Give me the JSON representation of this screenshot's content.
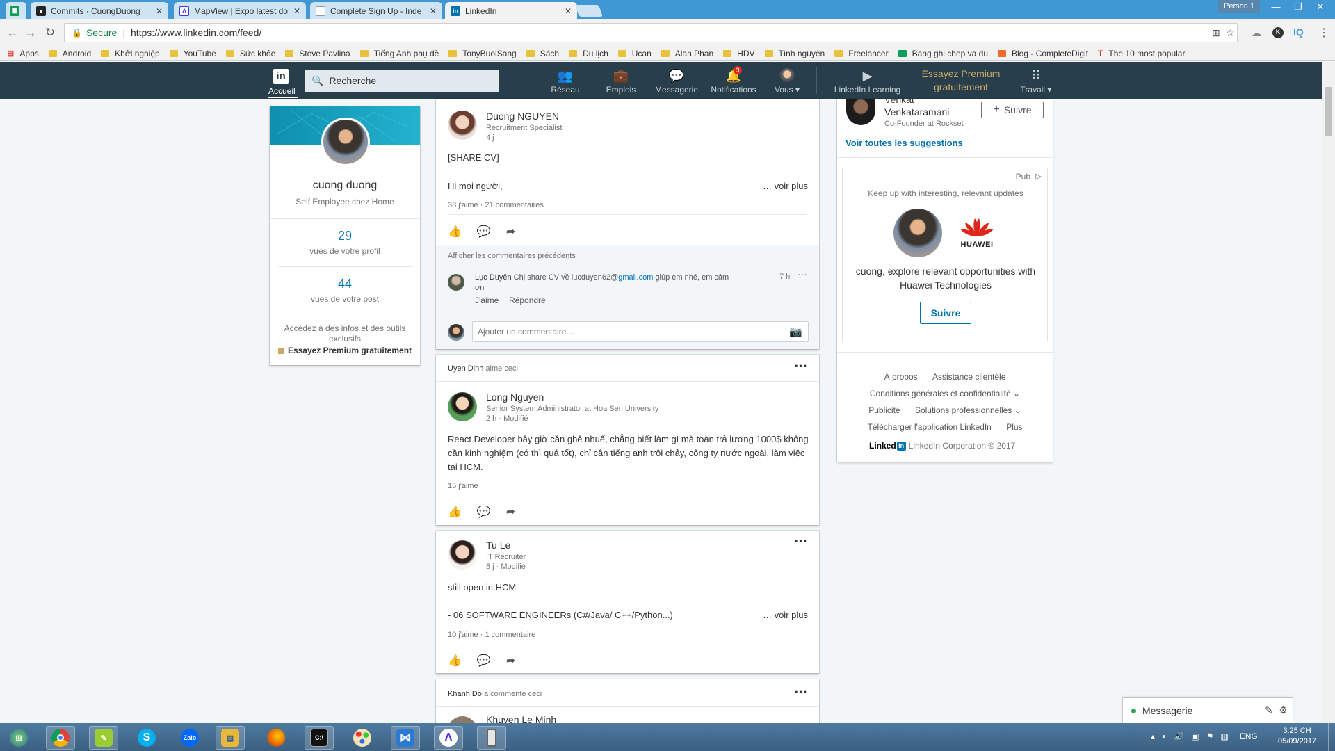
{
  "browser": {
    "tabs": [
      {
        "title": "Commits · CuongDuong",
        "icon": "github-icon"
      },
      {
        "title": "MapView | Expo latest do",
        "icon": "expo-icon"
      },
      {
        "title": "Complete Sign Up - Inde",
        "icon": "page-icon"
      },
      {
        "title": "LinkedIn",
        "icon": "linkedin-icon",
        "active": true
      }
    ],
    "profile_button": "Person 1",
    "secure_label": "Secure",
    "url": "https://www.linkedin.com/feed/",
    "bookmarks": [
      "Apps",
      "Android",
      "Khởi nghiệp",
      "YouTube",
      "Sức khỏe",
      "Steve Pavlina",
      "Tiếng Anh phụ đề",
      "TonyBuoiSang",
      "Sách",
      "Du lịch",
      "Ucan",
      "Alan Phan",
      "HDV",
      "Tình nguyện",
      "Freelancer",
      "Bang ghi chep va du",
      "Blog - CompleteDigit",
      "The 10 most popular"
    ],
    "extension_label": "IQ"
  },
  "linkedin_header": {
    "home": "Accueil",
    "search_placeholder": "Recherche",
    "nav": [
      "Réseau",
      "Emplois",
      "Messagerie",
      "Notifications",
      "Vous",
      "LinkedIn Learning",
      "Travail"
    ],
    "notifications_count": "3",
    "premium": "Essayez Premium gratuitement"
  },
  "profile_card": {
    "name": "cuong duong",
    "headline": "Self Employee chez Home",
    "profile_views": "29",
    "profile_views_label": "vues de votre profil",
    "post_views": "44",
    "post_views_label": "vues de votre post",
    "premium_text": "Accédez à des infos et des outils exclusifs",
    "premium_link": "Essayez Premium gratuitement"
  },
  "feed": {
    "post1": {
      "name": "Duong NGUYEN",
      "title": "Recruitment Specialist",
      "time": "4 j",
      "text1": "[SHARE CV]",
      "text2": "Hi mọi người,",
      "see_more": "… voir plus",
      "stats": "38 j'aime · 21 commentaires",
      "prev_comments": "Afficher les commentaires précédents",
      "comment": {
        "author": "Lục Duyên",
        "text_a": "Chị share CV về lucduyen62@",
        "text_link": "gmail.com",
        "text_b": " giúp em nhé, em cảm",
        "text_c": "ơn",
        "time": "7 h",
        "like": "J'aime",
        "reply": "Répondre"
      },
      "comment_placeholder": "Ajouter un commentaire…"
    },
    "post2": {
      "context_name": "Uyen Dinh",
      "context_action": "aime ceci",
      "name": "Long Nguyen",
      "title": "Senior System Administrator at Hoa Sen University",
      "time": "2 h · Modifié",
      "text": "React Developer bây giờ cần ghê nhuế, chẳng biết làm gì mà toàn trả lương 1000$ không cần kinh nghiệm (có thì quá tốt), chỉ cần tiếng anh trôi chảy, công ty nước ngoài, làm việc tại HCM.",
      "stats": "15 j'aime"
    },
    "post3": {
      "name": "Tu Le",
      "title": "IT Recruiter",
      "time": "5 j · Modifié",
      "text1": "still open in HCM",
      "text2": "- 06 SOFTWARE ENGINEERs (C#/Java/ C++/Python...)",
      "see_more": "… voir plus",
      "stats": "10 j'aime · 1 commentaire"
    },
    "post4": {
      "context_name": "Khanh Do",
      "context_action": "a commenté ceci",
      "name": "Khuyen Le Minh"
    }
  },
  "right_rail": {
    "suggestion": {
      "name_line1": "Venkat",
      "name_line2": "Venkataramani",
      "headline": "Co-Founder at Rockset",
      "follow": "Suivre"
    },
    "see_all": "Voir toutes les suggestions",
    "ad": {
      "label": "Pub",
      "tagline": "Keep up with interesting, relevant updates",
      "brand": "HUAWEI",
      "message_line1": "cuong, explore relevant opportunities with",
      "message_line2": "Huawei Technologies",
      "button": "Suivre"
    },
    "footer": {
      "links": [
        "À propos",
        "Assistance clientèle",
        "Conditions générales et confidentialité",
        "Publicité",
        "Solutions professionnelles",
        "Télécharger l'application LinkedIn",
        "Plus"
      ],
      "logo_text": "Linked",
      "copyright": "LinkedIn Corporation © 2017"
    }
  },
  "messaging": {
    "label": "Messagerie"
  },
  "taskbar": {
    "language": "ENG",
    "time": "3:25 CH",
    "date": "05/09/2017",
    "apps": [
      "start-orb-icon",
      "chrome-icon",
      "notepad-icon",
      "skype-icon",
      "zalo-icon",
      "file-explorer-icon",
      "firefox-icon",
      "cmd-icon",
      "paint-icon",
      "vscode-icon",
      "expo-icon",
      "phone-icon"
    ]
  },
  "colors": {
    "linkedin_nav": "#283e4a",
    "linkedin_blue": "#0073b1",
    "premium_gold": "#c9a869",
    "tab_bar": "#3f97d4",
    "huawei_red": "#e0261b"
  }
}
